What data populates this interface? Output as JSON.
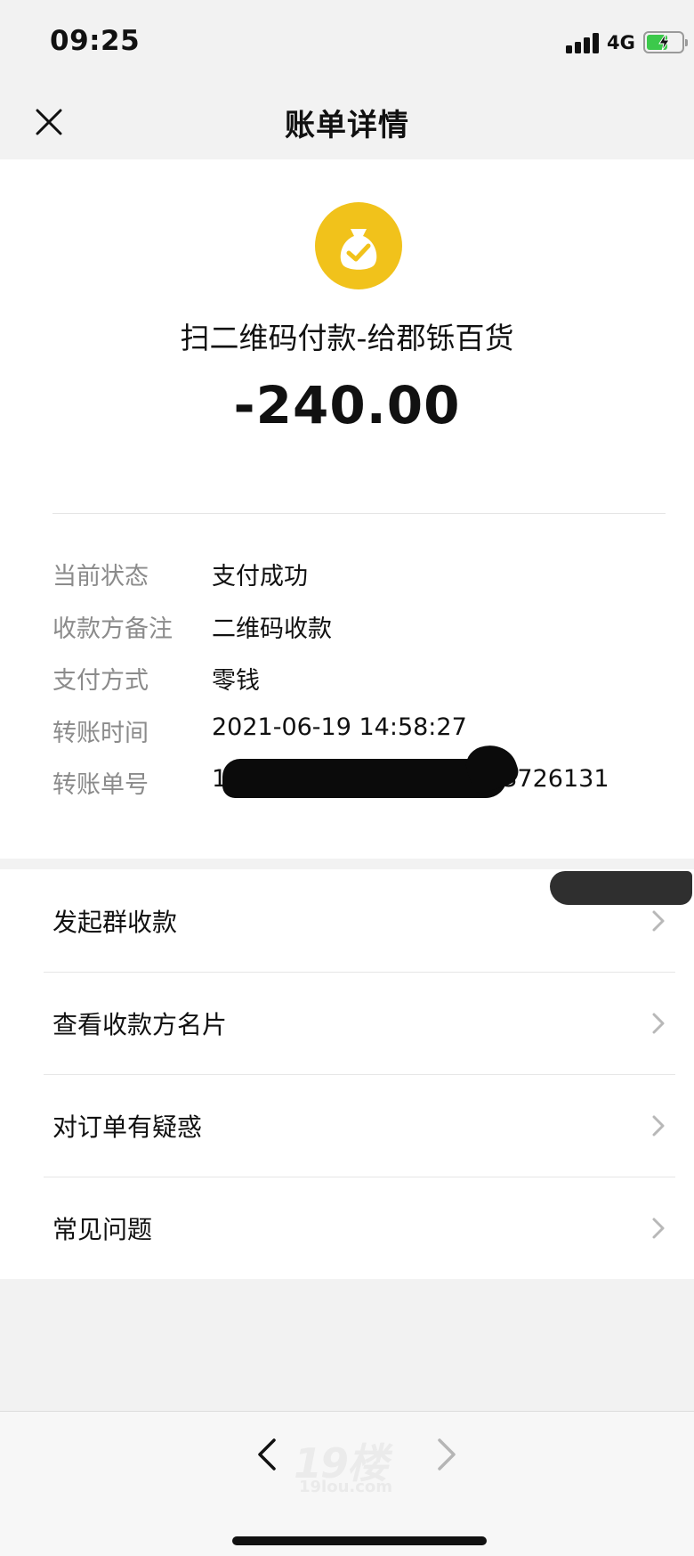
{
  "status_bar": {
    "time": "09:25",
    "network": "4G",
    "battery_level": 0.6,
    "battery_charging": true
  },
  "nav": {
    "title": "账单详情",
    "close_icon": "close-icon"
  },
  "payment": {
    "icon": "money-bag-check-icon",
    "icon_color": "#f1c21b",
    "merchant": "扫二维码付款-给郡铄百货",
    "amount": "-240.00"
  },
  "details": [
    {
      "label": "当前状态",
      "value": "支付成功"
    },
    {
      "label": "收款方备注",
      "value": "二维码收款"
    },
    {
      "label": "支付方式",
      "value": "零钱"
    },
    {
      "label": "转账时间",
      "value": "2021-06-19 14:58:27"
    },
    {
      "label": "转账单号",
      "value": "10                    00191123726131"
    }
  ],
  "menu": [
    {
      "label": "发起群收款",
      "icon": "chevron-right-icon"
    },
    {
      "label": "查看收款方名片",
      "icon": "chevron-right-icon"
    },
    {
      "label": "对订单有疑惑",
      "icon": "chevron-right-icon"
    },
    {
      "label": "常见问题",
      "icon": "chevron-right-icon"
    }
  ],
  "toolbar": {
    "back_icon": "chevron-left-icon",
    "forward_icon": "chevron-right-icon",
    "watermark_number": "19楼",
    "watermark_site": "19lou.com"
  }
}
